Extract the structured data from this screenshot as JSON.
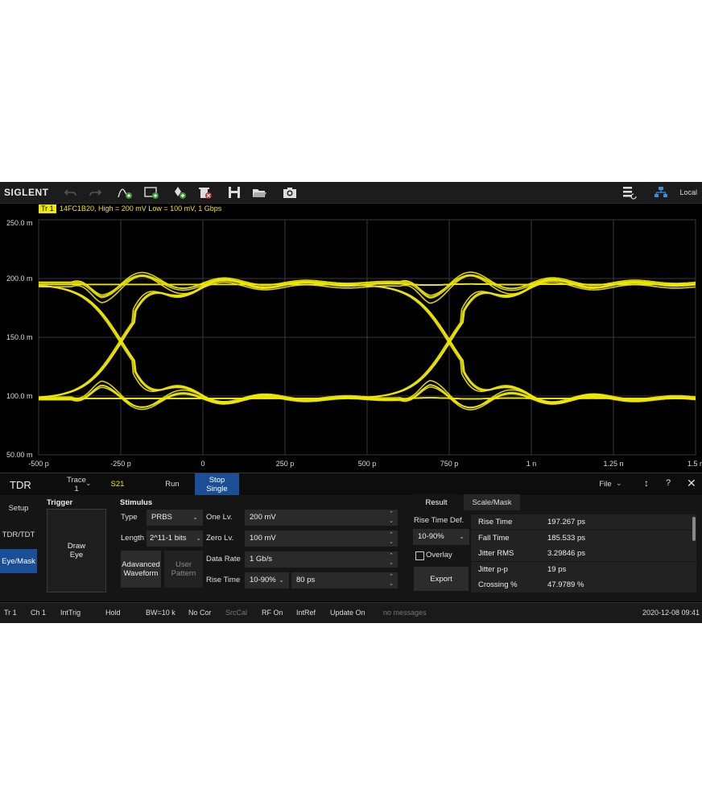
{
  "toolbar": {
    "brand": "SIGLENT",
    "local_label": "Local",
    "icons": [
      "undo-icon",
      "redo-icon",
      "add-trace-icon",
      "add-window-icon",
      "add-marker-icon",
      "delete-icon",
      "save-icon",
      "open-folder-icon",
      "camera-icon",
      "display-layout-icon",
      "network-icon"
    ]
  },
  "trace_banner": {
    "tag": "Tr 1",
    "info": "14FC1B20,  High = 200 mV  Low = 100 mV,  1 Gbps"
  },
  "chart_data": {
    "type": "line",
    "title": "",
    "xlabel": "",
    "ylabel": "",
    "x_ticks": [
      "-500 p",
      "-250 p",
      "0",
      "250 p",
      "500 p",
      "750 p",
      "1 n",
      "1.25 n",
      "1.5 n"
    ],
    "y_ticks": [
      "250.0 m",
      "200.0 m",
      "150.0 m",
      "100.0 m",
      "50.00 m"
    ],
    "xlim_ps": [
      -500,
      1500
    ],
    "ylim_mV": [
      50,
      250
    ],
    "grid": true,
    "trace_color": "#f0e800",
    "eye": {
      "high_mV": 200,
      "low_mV": 100,
      "settled_high_mV": 195,
      "settled_low_mV": 98,
      "crossings_ps": [
        -250,
        750
      ],
      "crossing_level_mV": 145,
      "overshoot_mV": 12,
      "ringing_period_ps": 250
    }
  },
  "tabs": {
    "title": "TDR",
    "trace_label": "Trace",
    "trace_value": "1",
    "sparam": "S21",
    "run": "Run",
    "stop_single": "Stop\nSingle",
    "file": "File"
  },
  "side_tabs": [
    "Setup",
    "TDR/TDT",
    "Eye/Mask"
  ],
  "trigger": {
    "title": "Trigger",
    "draw_eye": "Draw\nEye"
  },
  "stimulus": {
    "title": "Stimulus",
    "type_label": "Type",
    "type_value": "PRBS",
    "length_label": "Length",
    "length_value": "2^11-1 bits",
    "one_label": "One Lv.",
    "one_value": "200 mV",
    "zero_label": "Zero Lv.",
    "zero_value": "100 mV",
    "rate_label": "Data Rate",
    "rate_value": "1 Gb/s",
    "rise_label": "Rise Time",
    "rise_def": "10-90%",
    "rise_value": "80 ps",
    "adv_waveform": "Adavanced\nWaveform",
    "user_pattern": "User\nPattern"
  },
  "result": {
    "tab_result": "Result",
    "tab_scale": "Scale/Mask",
    "rise_def_label": "Rise Time Def.",
    "rise_def_value": "10-90%",
    "overlay": "Overlay",
    "export": "Export",
    "rows": [
      {
        "name": "Rise Time",
        "value": "197.267 ps"
      },
      {
        "name": "Fall Time",
        "value": "185.533 ps"
      },
      {
        "name": "Jitter RMS",
        "value": "3.29846 ps"
      },
      {
        "name": "Jitter p-p",
        "value": "19 ps"
      },
      {
        "name": "Crossing %",
        "value": "47.9789 %"
      }
    ]
  },
  "status": {
    "tr": "Tr 1",
    "ch": "Ch 1",
    "trig": "IntTrig",
    "hold": "Hold",
    "bw": "BW=10 k",
    "cor": "No Cor",
    "srccal": "SrcCal",
    "rf": "RF On",
    "ref": "IntRef",
    "update": "Update On",
    "messages": "no messages",
    "datetime": "2020-12-08 09:41"
  }
}
